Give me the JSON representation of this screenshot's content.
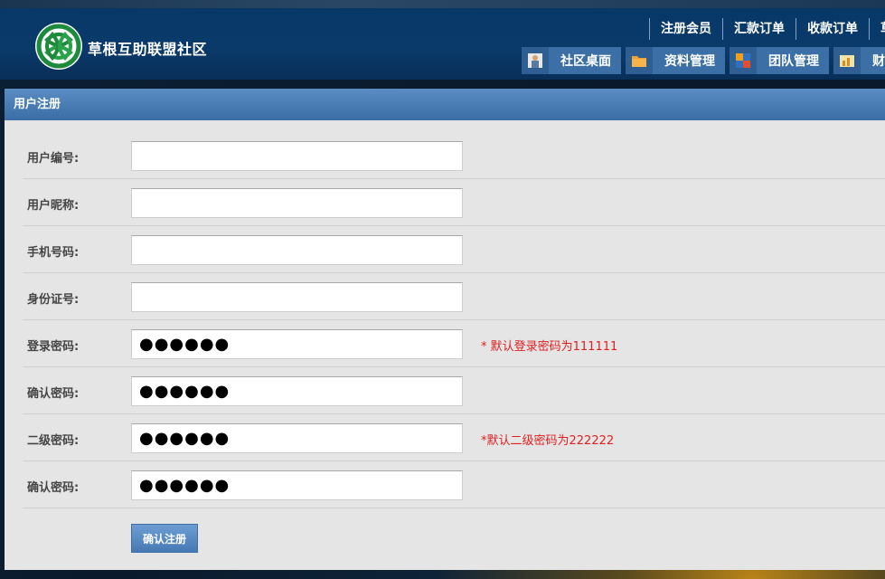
{
  "header": {
    "brand": "草根互助联盟社区",
    "top_links": [
      "注册会员",
      "汇款订单",
      "收款订单",
      "草"
    ],
    "nav": [
      {
        "label": "社区桌面",
        "icon": "desk-person-icon"
      },
      {
        "label": "资料管理",
        "icon": "folder-icon"
      },
      {
        "label": "团队管理",
        "icon": "team-icon"
      },
      {
        "label": "财",
        "icon": "finance-icon"
      }
    ]
  },
  "panel": {
    "title": "用户注册",
    "fields": [
      {
        "label": "用户编号:",
        "value": "",
        "hint": ""
      },
      {
        "label": "用户昵称:",
        "value": "",
        "hint": ""
      },
      {
        "label": "手机号码:",
        "value": "",
        "hint": ""
      },
      {
        "label": "身份证号:",
        "value": "",
        "hint": ""
      },
      {
        "label": "登录密码:",
        "value": "●●●●●●",
        "hint": "* 默认登录密码为111111"
      },
      {
        "label": "确认密码:",
        "value": "●●●●●●",
        "hint": ""
      },
      {
        "label": "二级密码:",
        "value": "●●●●●●",
        "hint": "*默认二级密码为222222"
      },
      {
        "label": "确认密码:",
        "value": "●●●●●●",
        "hint": ""
      }
    ],
    "submit_label": "确认注册"
  },
  "colors": {
    "header": "#0a3a6a",
    "nav_button": "#3c6fa6",
    "panel_bg": "#e5e5e5",
    "hint": "#e02020"
  }
}
